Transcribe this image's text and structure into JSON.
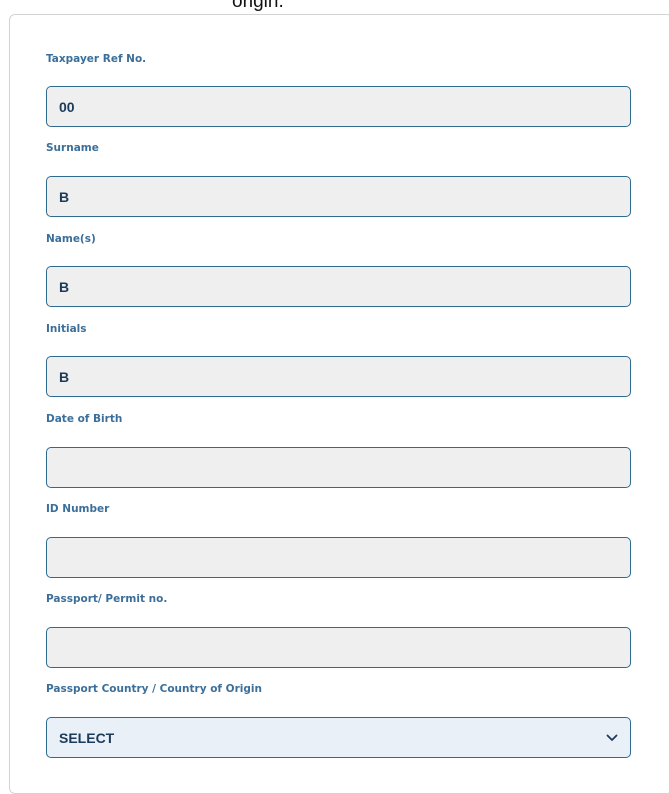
{
  "heading_fragment": "origin.",
  "form": {
    "fields": [
      {
        "label": "Taxpayer Ref No.",
        "value": "00"
      },
      {
        "label": "Surname",
        "value": "B"
      },
      {
        "label": "Name(s)",
        "value": "B"
      },
      {
        "label": "Initials",
        "value": "B"
      },
      {
        "label": "Date of Birth",
        "value": ""
      },
      {
        "label": "ID Number",
        "value": ""
      },
      {
        "label": "Passport/ Permit no.",
        "value": ""
      }
    ],
    "country": {
      "label": "Passport Country / Country of Origin",
      "selected": "SELECT",
      "icon": "chevron-down-icon"
    }
  },
  "colors": {
    "label": "#3b6f9a",
    "input_border": "#2e6b8f",
    "input_bg": "#efefef",
    "value_text": "#1c3b5a"
  }
}
